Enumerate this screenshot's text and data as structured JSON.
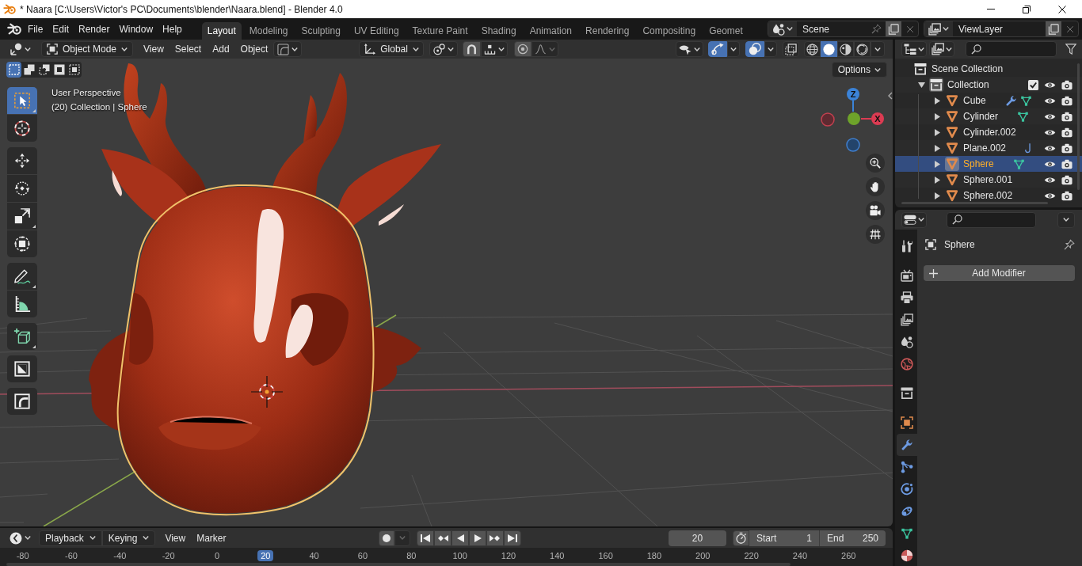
{
  "window": {
    "title": "* Naara [C:\\Users\\Victor's PC\\Documents\\blender\\Naara.blend] - Blender 4.0"
  },
  "menu": [
    "File",
    "Edit",
    "Render",
    "Window",
    "Help"
  ],
  "workspaces": [
    {
      "label": "Layout",
      "selected": true
    },
    {
      "label": "Modeling",
      "selected": false
    },
    {
      "label": "Sculpting",
      "selected": false
    },
    {
      "label": "UV Editing",
      "selected": false
    },
    {
      "label": "Texture Paint",
      "selected": false
    },
    {
      "label": "Shading",
      "selected": false
    },
    {
      "label": "Animation",
      "selected": false
    },
    {
      "label": "Rendering",
      "selected": false
    },
    {
      "label": "Compositing",
      "selected": false
    },
    {
      "label": "Geomet",
      "selected": false
    }
  ],
  "scene": {
    "value": "Scene"
  },
  "view_layer": {
    "value": "ViewLayer"
  },
  "viewport": {
    "mode": "Object Mode",
    "menus": [
      "View",
      "Select",
      "Add",
      "Object"
    ],
    "orientation": "Global",
    "snap": false,
    "proportional": false,
    "gizmos": true,
    "overlays": true,
    "xray": false,
    "shading": [
      {
        "kind": "wireframe",
        "selected": false
      },
      {
        "kind": "solid",
        "selected": true
      },
      {
        "kind": "material",
        "selected": false
      },
      {
        "kind": "rendered",
        "selected": false
      }
    ],
    "select_modes": [
      {
        "kind": "set",
        "selected": true
      },
      {
        "kind": "extend",
        "selected": false
      },
      {
        "kind": "subtract",
        "selected": false
      },
      {
        "kind": "invert",
        "selected": false
      },
      {
        "kind": "intersect",
        "selected": false
      }
    ],
    "options": "Options",
    "info": [
      "User Perspective",
      "(20) Collection | Sphere"
    ],
    "tool_groups": [
      {
        "tools": [
          {
            "kind": "select_box",
            "selected": true,
            "submenu": true
          },
          {
            "kind": "cursor",
            "selected": false,
            "submenu": false
          }
        ]
      },
      {
        "tools": [
          {
            "kind": "move",
            "selected": false,
            "submenu": false
          },
          {
            "kind": "rotate",
            "selected": false,
            "submenu": false
          },
          {
            "kind": "scale",
            "selected": false,
            "submenu": true
          },
          {
            "kind": "transform",
            "selected": false,
            "submenu": false
          }
        ]
      },
      {
        "tools": [
          {
            "kind": "annotate",
            "selected": false,
            "submenu": true
          },
          {
            "kind": "measure",
            "selected": false,
            "submenu": false
          }
        ]
      },
      {
        "tools": [
          {
            "kind": "add_cube",
            "selected": false,
            "submenu": true
          }
        ]
      },
      {
        "tools": [
          {
            "kind": "shear",
            "selected": false,
            "submenu": false
          }
        ]
      },
      {
        "tools": [
          {
            "kind": "bend",
            "selected": false,
            "submenu": false
          }
        ]
      }
    ],
    "nav_gizmo": [
      {
        "kind": "neg_x"
      },
      {
        "kind": "neg_z"
      },
      {
        "kind": "z",
        "label": "Z"
      },
      {
        "kind": "x",
        "label": "X"
      },
      {
        "kind": "y"
      }
    ],
    "nav_buttons": [
      {
        "kind": "zoom"
      },
      {
        "kind": "pan"
      },
      {
        "kind": "camera"
      },
      {
        "kind": "ortho"
      }
    ]
  },
  "outliner": {
    "kind": "scene_collection",
    "label": "Scene Collection",
    "selected": false,
    "children": [
      {
        "kind": "collection",
        "label": "Collection",
        "expanded": true,
        "checked": true,
        "active": true,
        "selected": false,
        "children": [
          {
            "kind": "object",
            "label": "Cube",
            "expanded": false,
            "selected": false,
            "extras": [
              {
                "kind": "modifier"
              },
              {
                "kind": "mesh"
              }
            ]
          },
          {
            "kind": "object",
            "label": "Cylinder",
            "expanded": false,
            "selected": false,
            "extras": [
              {
                "kind": "mesh"
              }
            ]
          },
          {
            "kind": "object",
            "label": "Cylinder.002",
            "expanded": false,
            "selected": false
          },
          {
            "kind": "object",
            "label": "Plane.002",
            "expanded": false,
            "selected": false,
            "extras": [
              {
                "kind": "hook"
              }
            ]
          },
          {
            "kind": "object",
            "label": "Sphere",
            "expanded": false,
            "selected": true,
            "extras": [
              {
                "kind": "mesh"
              }
            ]
          },
          {
            "kind": "object",
            "label": "Sphere.001",
            "expanded": false,
            "selected": false
          },
          {
            "kind": "object",
            "label": "Sphere.002",
            "expanded": false,
            "selected": false
          }
        ]
      }
    ]
  },
  "properties": {
    "tab_groups": [
      {
        "tabs": [
          {
            "kind": "tool",
            "selected": false
          }
        ]
      },
      {
        "tabs": [
          {
            "kind": "render",
            "selected": false
          },
          {
            "kind": "output",
            "selected": false
          },
          {
            "kind": "view_layer",
            "selected": false
          },
          {
            "kind": "scene",
            "selected": false
          },
          {
            "kind": "world",
            "selected": false
          }
        ]
      },
      {
        "tabs": [
          {
            "kind": "collection",
            "selected": false
          }
        ]
      },
      {
        "tabs": [
          {
            "kind": "object",
            "selected": false
          },
          {
            "kind": "modifiers",
            "selected": true
          },
          {
            "kind": "particles",
            "selected": false
          },
          {
            "kind": "physics",
            "selected": false
          },
          {
            "kind": "constraints",
            "selected": false
          },
          {
            "kind": "data",
            "selected": false
          },
          {
            "kind": "material",
            "selected": false
          }
        ]
      }
    ],
    "object": "Sphere",
    "add_button": "Add Modifier"
  },
  "timeline": {
    "menus": [
      {
        "kind": "dropdown",
        "label": "Playback"
      },
      {
        "kind": "dropdown",
        "label": "Keying"
      },
      {
        "kind": "menu",
        "label": "View"
      },
      {
        "kind": "menu",
        "label": "Marker"
      }
    ],
    "current_frame": "20",
    "start": {
      "label": "Start",
      "value": "1"
    },
    "end": {
      "label": "End",
      "value": "250"
    },
    "ruler": [
      {
        "label": "-80",
        "current": false
      },
      {
        "label": "-60",
        "current": false
      },
      {
        "label": "-40",
        "current": false
      },
      {
        "label": "-20",
        "current": false
      },
      {
        "label": "0",
        "current": false
      },
      {
        "label": "20",
        "current": true
      },
      {
        "label": "40",
        "current": false
      },
      {
        "label": "60",
        "current": false
      },
      {
        "label": "80",
        "current": false
      },
      {
        "label": "100",
        "current": false
      },
      {
        "label": "120",
        "current": false
      },
      {
        "label": "140",
        "current": false
      },
      {
        "label": "160",
        "current": false
      },
      {
        "label": "180",
        "current": false
      },
      {
        "label": "200",
        "current": false
      },
      {
        "label": "220",
        "current": false
      },
      {
        "label": "240",
        "current": false
      },
      {
        "label": "260",
        "current": false
      }
    ]
  }
}
